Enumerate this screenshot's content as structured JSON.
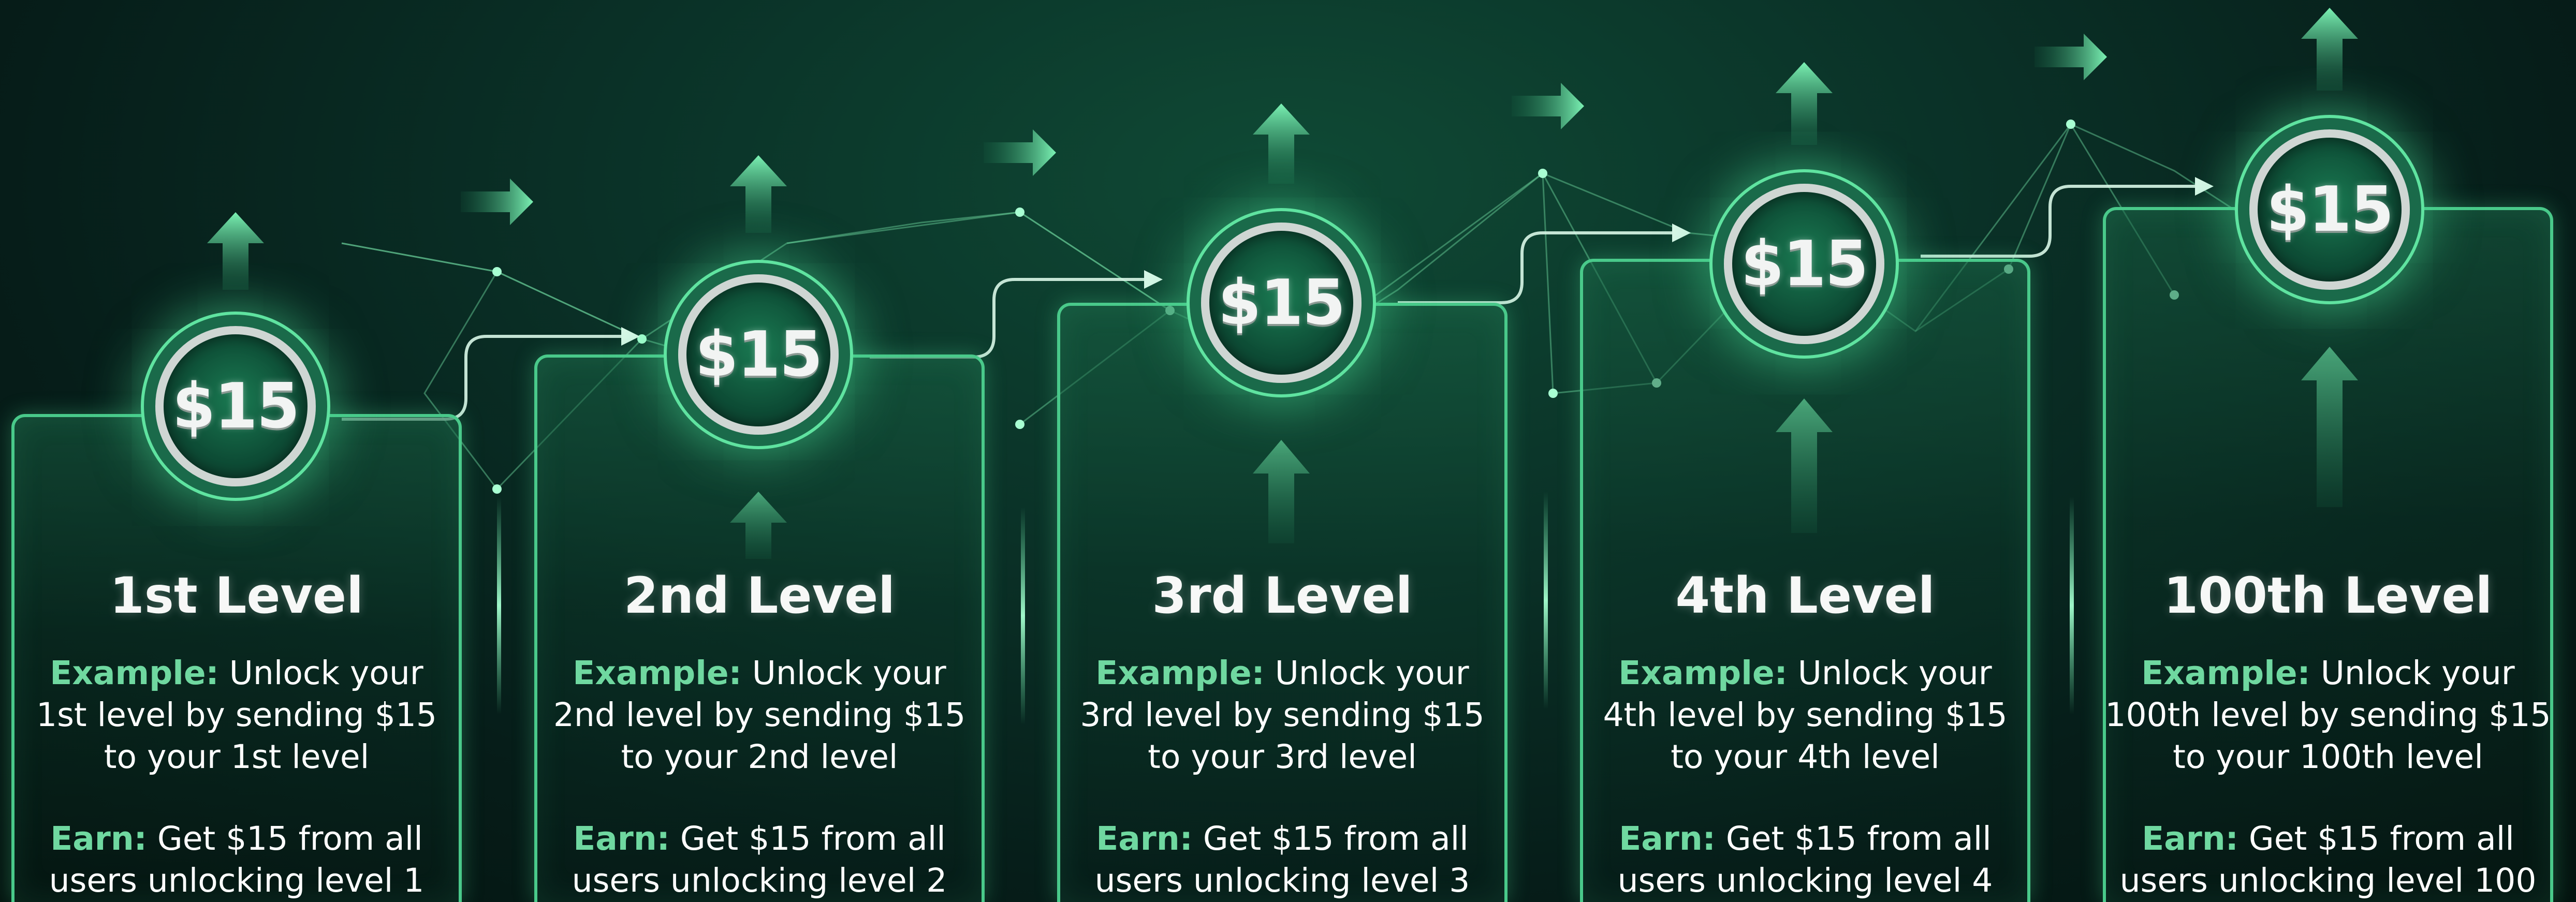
{
  "colors": {
    "accent": "#49c98a",
    "keyword": "#6fd8a0",
    "background": "#0a3127"
  },
  "icons": [
    "up-arrow-icon",
    "right-arrow-icon",
    "connector-arrow-icon"
  ],
  "levels": [
    {
      "coin": "$15",
      "title": "1st Level",
      "example_label": "Example:",
      "example_line1": "Unlock your",
      "example_line2": "1st level by sending $15",
      "example_line3": "to your 1st level",
      "earn_label": "Earn:",
      "earn_line1": "Get $15 from all",
      "earn_line2": "users unlocking level 1"
    },
    {
      "coin": "$15",
      "title": "2nd Level",
      "example_label": "Example:",
      "example_line1": "Unlock your",
      "example_line2": "2nd level by sending $15",
      "example_line3": "to your 2nd level",
      "earn_label": "Earn:",
      "earn_line1": "Get $15 from all",
      "earn_line2": "users unlocking level 2"
    },
    {
      "coin": "$15",
      "title": "3rd Level",
      "example_label": "Example:",
      "example_line1": "Unlock your",
      "example_line2": "3rd level by sending $15",
      "example_line3": "to your 3rd level",
      "earn_label": "Earn:",
      "earn_line1": "Get $15 from all",
      "earn_line2": "users unlocking level 3"
    },
    {
      "coin": "$15",
      "title": "4th Level",
      "example_label": "Example:",
      "example_line1": "Unlock your",
      "example_line2": "4th level by sending $15",
      "example_line3": "to your 4th level",
      "earn_label": "Earn:",
      "earn_line1": "Get $15 from all",
      "earn_line2": "users unlocking level 4"
    },
    {
      "coin": "$15",
      "title": "100th Level",
      "example_label": "Example:",
      "example_line1": "Unlock your",
      "example_line2": "100th level by sending $15",
      "example_line3": "to your 100th level",
      "earn_label": "Earn:",
      "earn_line1": "Get $15 from all",
      "earn_line2": "users unlocking level 100"
    }
  ]
}
